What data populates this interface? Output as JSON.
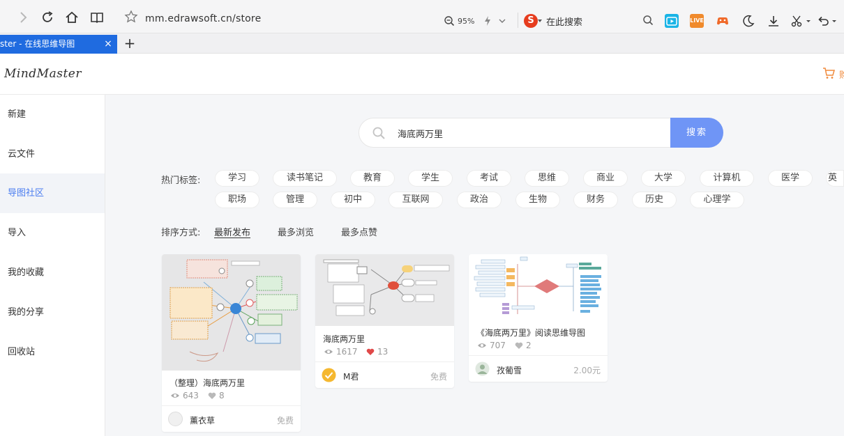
{
  "browser": {
    "url": "mm.edrawsoft.cn/store",
    "zoom": "95%",
    "search_placeholder": "在此搜索",
    "engine_letter": "S",
    "tab_title": "ster - 在线思维导图",
    "tab_close": "×",
    "new_tab": "+",
    "ext_live_label": "LIVE"
  },
  "app": {
    "logo": "MindMaster",
    "cart_label": "购"
  },
  "sidebar": {
    "items": [
      {
        "label": "新建"
      },
      {
        "label": "云文件"
      },
      {
        "label": "导图社区"
      },
      {
        "label": "导入"
      },
      {
        "label": "我的收藏"
      },
      {
        "label": "我的分享"
      },
      {
        "label": "回收站"
      }
    ],
    "active_index": 2
  },
  "search": {
    "value": "海底两万里",
    "button": "搜索"
  },
  "tags": {
    "label": "热门标签:",
    "row1": [
      "学习",
      "读书笔记",
      "教育",
      "学生",
      "考试",
      "思维",
      "商业",
      "大学",
      "计算机",
      "医学",
      "英"
    ],
    "row2": [
      "职场",
      "管理",
      "初中",
      "互联网",
      "政治",
      "生物",
      "财务",
      "历史",
      "心理学"
    ]
  },
  "sort": {
    "label": "排序方式:",
    "options": [
      "最新发布",
      "最多浏览",
      "最多点赞"
    ],
    "active": "最新发布"
  },
  "cards": [
    {
      "title": "（整理）海底两万里",
      "views": "643",
      "likes": "8",
      "author": "薰衣草",
      "price": "免费",
      "liked": false
    },
    {
      "title": "海底两万里",
      "views": "1617",
      "likes": "13",
      "author": "M君",
      "price": "免费",
      "liked": true
    },
    {
      "title": "《海底两万里》阅读思维导图",
      "views": "707",
      "likes": "2",
      "author": "孜葡雪",
      "price": "2.00元",
      "liked": false
    }
  ],
  "colors": {
    "accent": "#4b7df0",
    "search_button": "#6f95f6",
    "tab_active": "#1f6be0",
    "like_active": "#e04848"
  }
}
